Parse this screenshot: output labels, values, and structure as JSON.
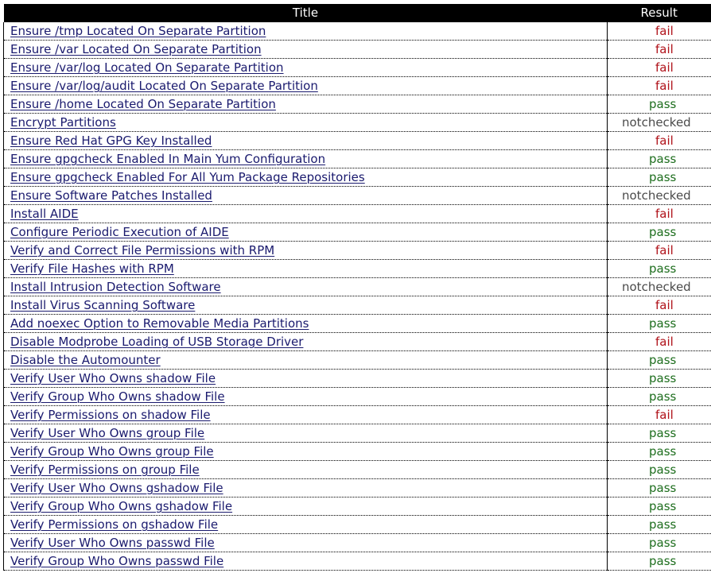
{
  "header": {
    "title_col": "Title",
    "result_col": "Result"
  },
  "colors": {
    "fail": "#b0121a",
    "pass": "#1e6e1e",
    "notchecked": "#4a4a4a",
    "link": "#1a1a6e",
    "header_bg": "#000000"
  },
  "rows": [
    {
      "title": "Ensure /tmp Located On Separate Partition",
      "result": "fail"
    },
    {
      "title": "Ensure /var Located On Separate Partition",
      "result": "fail"
    },
    {
      "title": "Ensure /var/log Located On Separate Partition",
      "result": "fail"
    },
    {
      "title": "Ensure /var/log/audit Located On Separate Partition",
      "result": "fail"
    },
    {
      "title": "Ensure /home Located On Separate Partition",
      "result": "pass"
    },
    {
      "title": "Encrypt Partitions",
      "result": "notchecked"
    },
    {
      "title": "Ensure Red Hat GPG Key Installed",
      "result": "fail"
    },
    {
      "title": "Ensure gpgcheck Enabled In Main Yum Configuration",
      "result": "pass"
    },
    {
      "title": "Ensure gpgcheck Enabled For All Yum Package Repositories",
      "result": "pass"
    },
    {
      "title": "Ensure Software Patches Installed",
      "result": "notchecked"
    },
    {
      "title": "Install AIDE",
      "result": "fail"
    },
    {
      "title": "Configure Periodic Execution of AIDE",
      "result": "pass"
    },
    {
      "title": "Verify and Correct File Permissions with RPM",
      "result": "fail"
    },
    {
      "title": "Verify File Hashes with RPM",
      "result": "pass"
    },
    {
      "title": "Install Intrusion Detection Software",
      "result": "notchecked"
    },
    {
      "title": "Install Virus Scanning Software",
      "result": "fail"
    },
    {
      "title": "Add noexec Option to Removable Media Partitions",
      "result": "pass"
    },
    {
      "title": "Disable Modprobe Loading of USB Storage Driver",
      "result": "fail"
    },
    {
      "title": "Disable the Automounter",
      "result": "pass"
    },
    {
      "title": "Verify User Who Owns shadow File",
      "result": "pass"
    },
    {
      "title": "Verify Group Who Owns shadow File",
      "result": "pass"
    },
    {
      "title": "Verify Permissions on shadow File",
      "result": "fail"
    },
    {
      "title": "Verify User Who Owns group File",
      "result": "pass"
    },
    {
      "title": "Verify Group Who Owns group File",
      "result": "pass"
    },
    {
      "title": "Verify Permissions on group File",
      "result": "pass"
    },
    {
      "title": "Verify User Who Owns gshadow File",
      "result": "pass"
    },
    {
      "title": "Verify Group Who Owns gshadow File",
      "result": "pass"
    },
    {
      "title": "Verify Permissions on gshadow File",
      "result": "pass"
    },
    {
      "title": "Verify User Who Owns passwd File",
      "result": "pass"
    },
    {
      "title": "Verify Group Who Owns passwd File",
      "result": "pass"
    }
  ]
}
